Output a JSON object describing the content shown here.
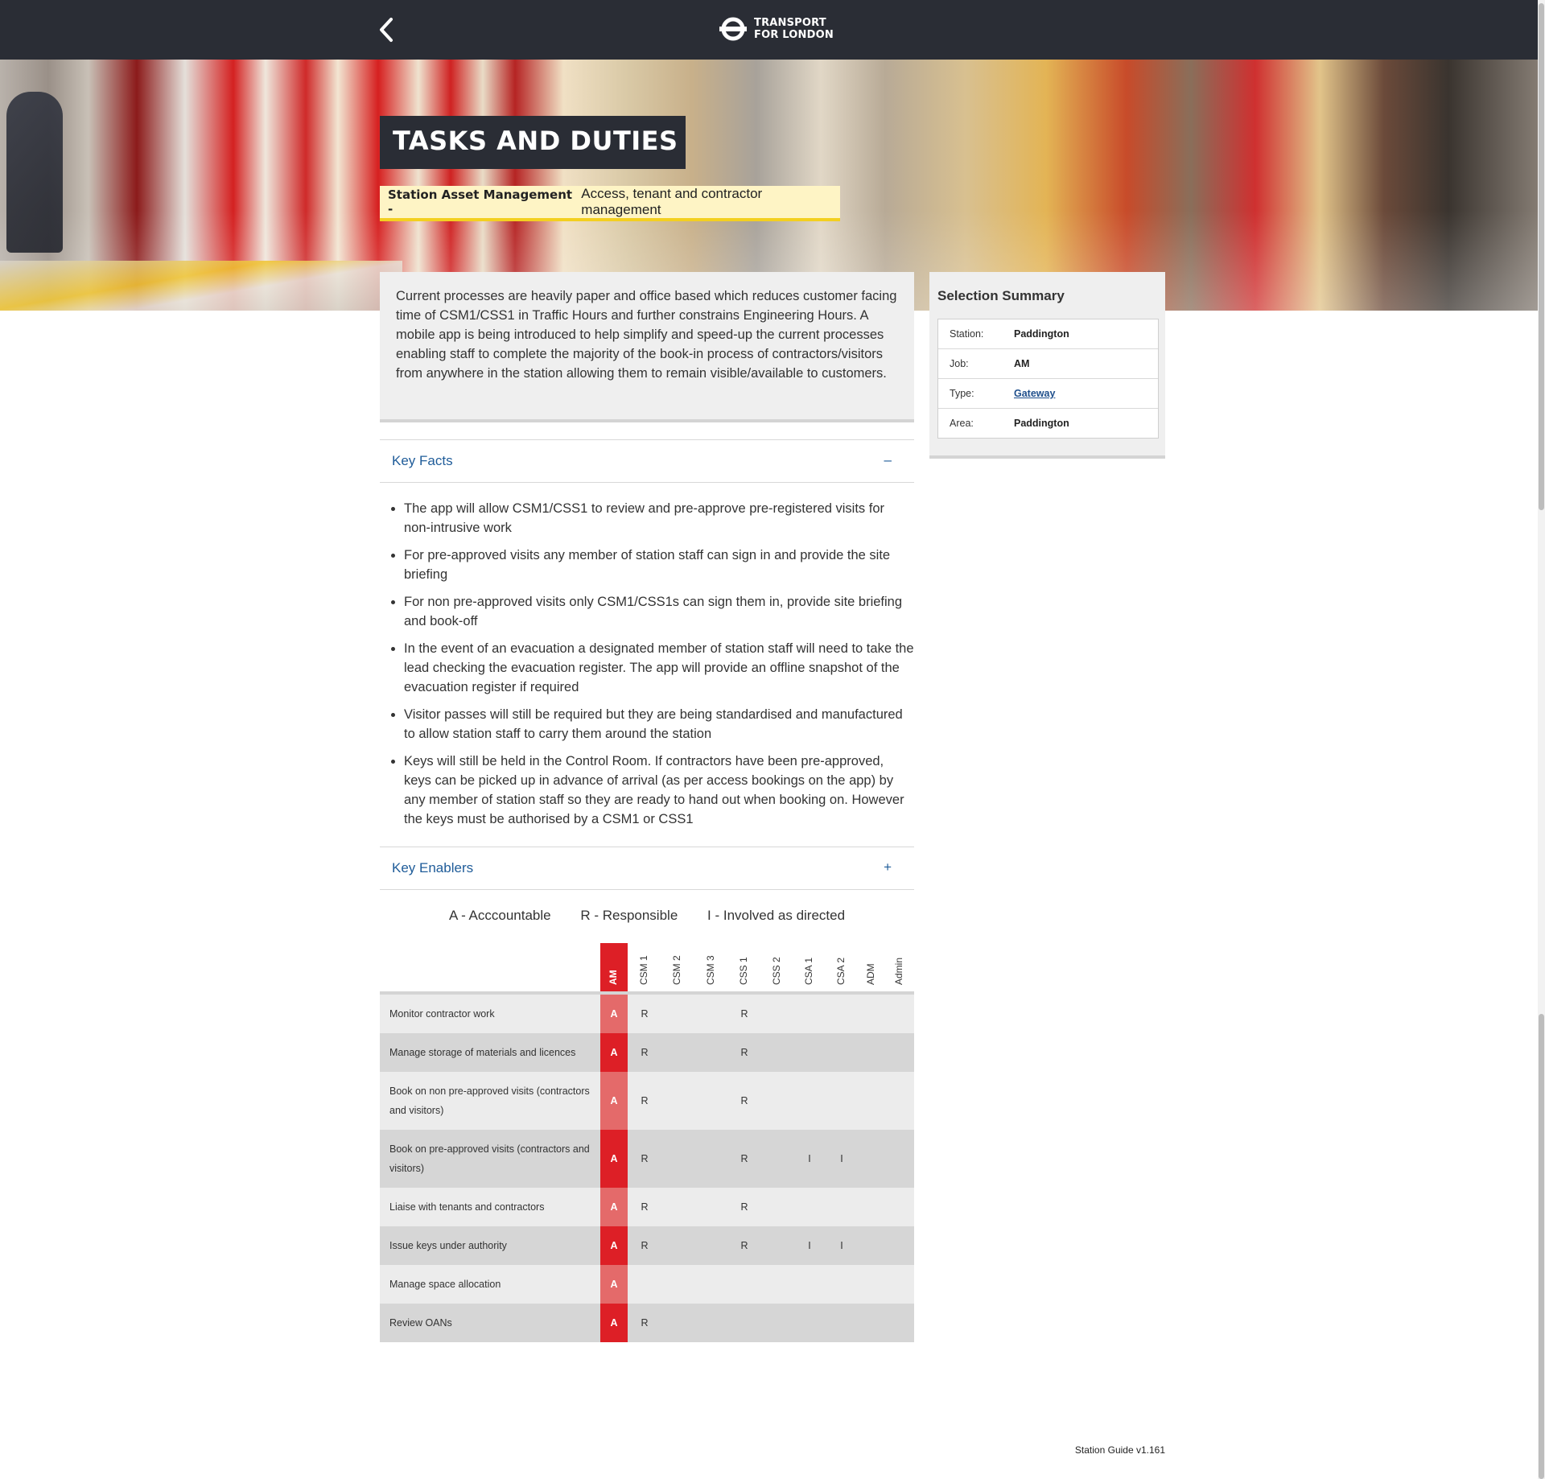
{
  "header": {
    "logo_line1": "TRANSPORT",
    "logo_line2": "FOR LONDON"
  },
  "hero": {
    "title": "TASKS AND DUTIES",
    "subtitle_bold": "Station Asset Management -",
    "subtitle": "Access, tenant and contractor management"
  },
  "intro": "Current processes are heavily paper and office based which reduces customer facing time of CSM1/CSS1 in Traffic Hours and further constrains Engineering Hours. A mobile app is being introduced to help simplify and speed-up the current processes enabling staff to complete the majority of the book-in process of contractors/visitors from anywhere in the station allowing them to remain visible/available to customers.",
  "summary": {
    "title": "Selection Summary",
    "rows": [
      {
        "key": "Station:",
        "value": "Paddington"
      },
      {
        "key": "Job:",
        "value": "AM"
      },
      {
        "key": "Type:",
        "value": "Gateway"
      },
      {
        "key": "Area:",
        "value": "Paddington"
      }
    ]
  },
  "key_facts": {
    "label": "Key Facts",
    "toggle": "–",
    "items": [
      "The app will allow CSM1/CSS1 to review and pre-approve pre-registered visits for non-intrusive work",
      "For pre-approved visits any member of station staff can sign in and provide the site briefing",
      "For non pre-approved visits only CSM1/CSS1s can sign them in, provide site briefing and book-off",
      "In the event of an evacuation a designated member of station staff will need to take the lead checking the evacuation register. The app will provide an offline snapshot of the evacuation register if required",
      "Visitor passes will still be required but they are being standardised and manufactured to allow station staff to carry them around the station",
      "Keys will still be held in the Control Room. If contractors have been pre-approved, keys can be picked up in advance of arrival (as per access bookings on the app) by any member of station staff so they are ready to hand out when booking on. However the keys must be authorised by a CSM1 or CSS1"
    ]
  },
  "key_enablers": {
    "label": "Key Enablers",
    "toggle": "+"
  },
  "legend": {
    "a": "A - Acccountable",
    "r": "R - Responsible",
    "i": "I - Involved as directed"
  },
  "raci": {
    "columns": [
      "AM",
      "CSM 1",
      "CSM 2",
      "CSM 3",
      "CSS 1",
      "CSS 2",
      "CSA 1",
      "CSA 2",
      "ADM",
      "Admin"
    ],
    "rows": [
      {
        "task": "Monitor contractor work",
        "cells": [
          "A",
          "R",
          "",
          "",
          "R",
          "",
          "",
          "",
          "",
          ""
        ]
      },
      {
        "task": "Manage storage of materials and licences",
        "cells": [
          "A",
          "R",
          "",
          "",
          "R",
          "",
          "",
          "",
          "",
          ""
        ]
      },
      {
        "task": "Book on non pre-approved visits (contractors and visitors)",
        "cells": [
          "A",
          "R",
          "",
          "",
          "R",
          "",
          "",
          "",
          "",
          ""
        ]
      },
      {
        "task": "Book on pre-approved visits (contractors and visitors)",
        "cells": [
          "A",
          "R",
          "",
          "",
          "R",
          "",
          "I",
          "I",
          "",
          ""
        ]
      },
      {
        "task": "Liaise with tenants and contractors",
        "cells": [
          "A",
          "R",
          "",
          "",
          "R",
          "",
          "",
          "",
          "",
          ""
        ]
      },
      {
        "task": "Issue keys under authority",
        "cells": [
          "A",
          "R",
          "",
          "",
          "R",
          "",
          "I",
          "I",
          "",
          ""
        ]
      },
      {
        "task": "Manage space allocation",
        "cells": [
          "A",
          "",
          "",
          "",
          "",
          "",
          "",
          "",
          "",
          ""
        ]
      },
      {
        "task": "Review OANs",
        "cells": [
          "A",
          "R",
          "",
          "",
          "",
          "",
          "",
          "",
          "",
          ""
        ]
      }
    ]
  },
  "footer": {
    "version": "Station Guide v1.161"
  },
  "colors": {
    "topbar": "#2a2d35",
    "accent_red": "#dd1f26",
    "link_blue": "#1f5c99",
    "highlight_yellow": "#fef4c5"
  }
}
